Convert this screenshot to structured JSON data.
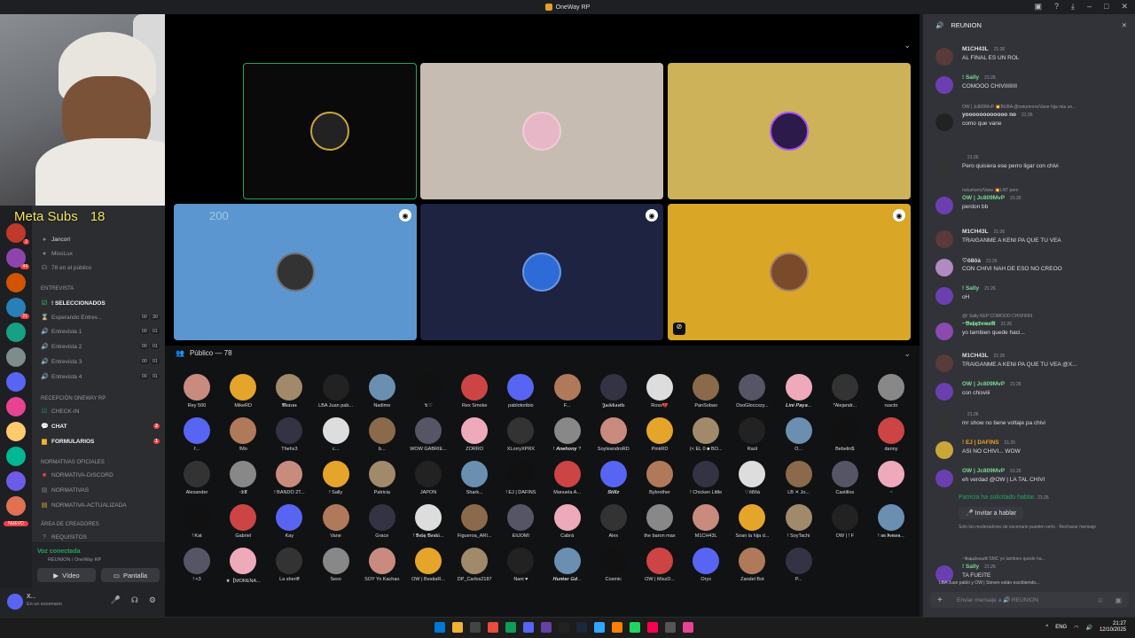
{
  "window": {
    "title": "OneWay RP"
  },
  "overlay": {
    "meta_subs": "Meta Subs",
    "subs_count": "18",
    "stage_count": "200"
  },
  "sidebar": {
    "voice_users": [
      "Jancorl",
      "MissLux",
      "78 en el público"
    ],
    "categories": [
      {
        "name": "ENTREVISTA",
        "channels": [
          {
            "label": "! SELECCIONADOS",
            "selected": true
          },
          {
            "label": "Esperando Entrev...",
            "counts": [
              "00",
              "30"
            ]
          },
          {
            "label": "Entrevista 1",
            "counts": [
              "00",
              "01"
            ]
          },
          {
            "label": "Entrevista 2",
            "counts": [
              "00",
              "01"
            ]
          },
          {
            "label": "Entrevista 3",
            "counts": [
              "00",
              "01"
            ]
          },
          {
            "label": "Entrevista 4",
            "counts": [
              "00",
              "01"
            ]
          }
        ]
      },
      {
        "name": "Recepción OneWay RP",
        "channels": [
          {
            "label": "CHECK-IN"
          },
          {
            "label": "CHAT",
            "badge": "2"
          },
          {
            "label": "FORMULARIOS",
            "badge": "1"
          }
        ]
      },
      {
        "name": "Normativas Oficiales",
        "channels": [
          {
            "label": "NORMATIVA-DISCORD"
          },
          {
            "label": "NORMATIVAS"
          },
          {
            "label": "NORMATIVA-ACTUALIZADA"
          }
        ]
      },
      {
        "name": "Área de creadores",
        "channels": [
          {
            "label": "REQUISITOS"
          }
        ]
      }
    ],
    "new_badge": "NUEVO"
  },
  "voice_panel": {
    "status": "Voz conectada",
    "sub": "REUNION / OneWay RP",
    "video_label": "Vídeo",
    "screen_label": "Pantalla"
  },
  "user": {
    "name": "X...",
    "status": "En un escenario"
  },
  "stage": {
    "public_label": "Público — 78",
    "members": [
      [
        "Rey 500",
        "MikeRD",
        "𝕸𝖆𝖗𝖈𝖔𝖘",
        "LBA Juan pab...",
        "Nadime",
        "↯♡",
        "Rex Smoke",
        "pablotoribio",
        "F...",
        "𝕵𝖆𝖈𝖐𝕮𝖆𝖘𝖙𝖑𝖊",
        "Ross💔",
        "PanSobao",
        "OsoGloccxzy...",
        "𝑳𝒊𝒏𝒊 𝑷𝒂𝒚𝒂...",
        "*Alejandr...",
        "ruscto"
      ],
      [
        "f...",
        "!Mo",
        "Thehx3",
        "c...",
        "b...",
        "WOW GABRIE...",
        "ZORRO",
        "XLorryXPRX",
        "! 𝑨𝒏𝒆𝒉𝒐𝒏𝒚 ?",
        "SoyleandroRD",
        "PinkRD",
        "(< EL 0 ■ BO...",
        "Raúl",
        "O...",
        "Bebelin$",
        "danny"
      ],
      [
        "Alexander",
        "-𝕯𝖀",
        "! BANDO 2T...",
        "! Sally",
        "Patricia",
        "JAPON",
        "Shark...",
        "! EJ | DAFINS",
        "Manuela A...",
        "𝑺𝒕𝒊𝒍𝒍𝒛",
        "Bybrother",
        "! Chicken Little",
        "♡ô8ôà",
        "LB ✕ Jo...",
        "Castillos",
        "~"
      ],
      [
        "! Kat",
        "Gabriel",
        "Kay",
        "Vane",
        "Grace",
        "! 𝕭𝖆𝖇𝖞 𝕭𝖆𝖓𝖐𝖎...",
        "Figueroa_ARI...",
        "EliJOMI",
        "Cabrá",
        "Alex",
        "the baron max",
        "M1CH43L",
        "Soan la hija d...",
        "! SoyTachi",
        "OW | ! F",
        "! 𝖚𝖓 𝖉𝖔𝖒𝖔𝖓..."
      ],
      [
        "! <3",
        "★【MORENA...",
        "La sheriff",
        "Sexo",
        "SOY Yo Kachao",
        "OW | BestiaR...",
        "DP_Carlos2187",
        "Nani ♥",
        "𝑯𝒖𝒏𝒕𝒆𝒓 𝑮𝒅...",
        "Cosmic",
        "OW | MiszD...",
        "Oryx",
        "Zandel Bot",
        "P..."
      ]
    ]
  },
  "chat": {
    "channel": "REUNION",
    "messages": [
      {
        "author": "M1CH43L",
        "time": "21:26",
        "text": "AL FINAL ES UN ROL",
        "color": "#e0e0e0"
      },
      {
        "author": "! Sally",
        "time": "21:26",
        "text": "COMOOO CHIVIIIIIIII",
        "color": "#7bd88f"
      },
      {
        "author": "yoooooooooooo no",
        "time": "21:26",
        "text": "como que vane",
        "color": "#dbdee1",
        "reply": "OW | Jc809MvP 💥BUBA @notumorrs/Vane hija mia un..."
      },
      {
        "author": "",
        "time": "21:26",
        "text": "Pero quisiera ese perro ligar con chivi",
        "color": "#dbdee1"
      },
      {
        "author": "OW | Jc809MvP",
        "time": "21:26",
        "text": "perdon bb",
        "color": "#7bd88f",
        "reply": "notumorrs/Vane 💥LNT pero"
      },
      {
        "author": "M1CH43L",
        "time": "21:26",
        "text": "TRAIGANME A KENI PA QUE TU VEA",
        "color": "#e0e0e0"
      },
      {
        "author": "♡ô8ôà",
        "time": "21:26",
        "text": "CON CHIVI NAH DE ESO NO CREOO",
        "color": "#dbdee1"
      },
      {
        "author": "! Sally",
        "time": "21:26",
        "text": "oH",
        "color": "#7bd88f"
      },
      {
        "author": "~𝕭𝖆𝖇𝖞𝕯𝖊𝖒𝖔𝕹",
        "time": "21:26",
        "text": "yo tambien quede haci...",
        "color": "#7bd88f",
        "reply": "@! Sally KEP COMOOO CHIVIIIIIIII"
      },
      {
        "author": "M1CH43L",
        "time": "21:26",
        "text": "TRAIGANME A KENI PA QUE TU VEA @X...",
        "color": "#e0e0e0"
      },
      {
        "author": "OW | Jc809MvP",
        "time": "21:26",
        "text": "con chisviii",
        "color": "#7bd88f"
      },
      {
        "author": "",
        "time": "21:26",
        "text": "mr show no tiene voltaje pa chivi",
        "color": "#dbdee1"
      },
      {
        "author": "! EJ | DAFINS",
        "time": "21:26",
        "text": "ASI NO CHIVI... WOW",
        "color": "#f0a020"
      },
      {
        "author": "OW | Jc809MvP",
        "time": "21:26",
        "text": "eh verdad @OW | LA TAL CHIVI",
        "color": "#7bd88f"
      },
      {
        "author": "! Sally",
        "time": "21:26",
        "text": "TA FUEITE",
        "color": "#7bd88f",
        "reply": "~𝕭𝖆𝖇𝖞𝕯𝖊𝖒𝖔𝕹 SMC yo tambien quede ha..."
      }
    ],
    "speak_request": "Patricia ha solicitado hablar.",
    "speak_time": "21:26",
    "invite_label": "Invitar a hablar",
    "moderator_note": "Solo los moderadores de escenario pueden verlo · Rechazar mensaje",
    "typing": "LBA Juan pablo y OW | Steven están escribiendo...",
    "input_placeholder": "Enviar mensaje a 🔊 REUNION"
  },
  "taskbar": {
    "lang": "ENG",
    "time": "21:27",
    "date": "12/10/2025"
  }
}
